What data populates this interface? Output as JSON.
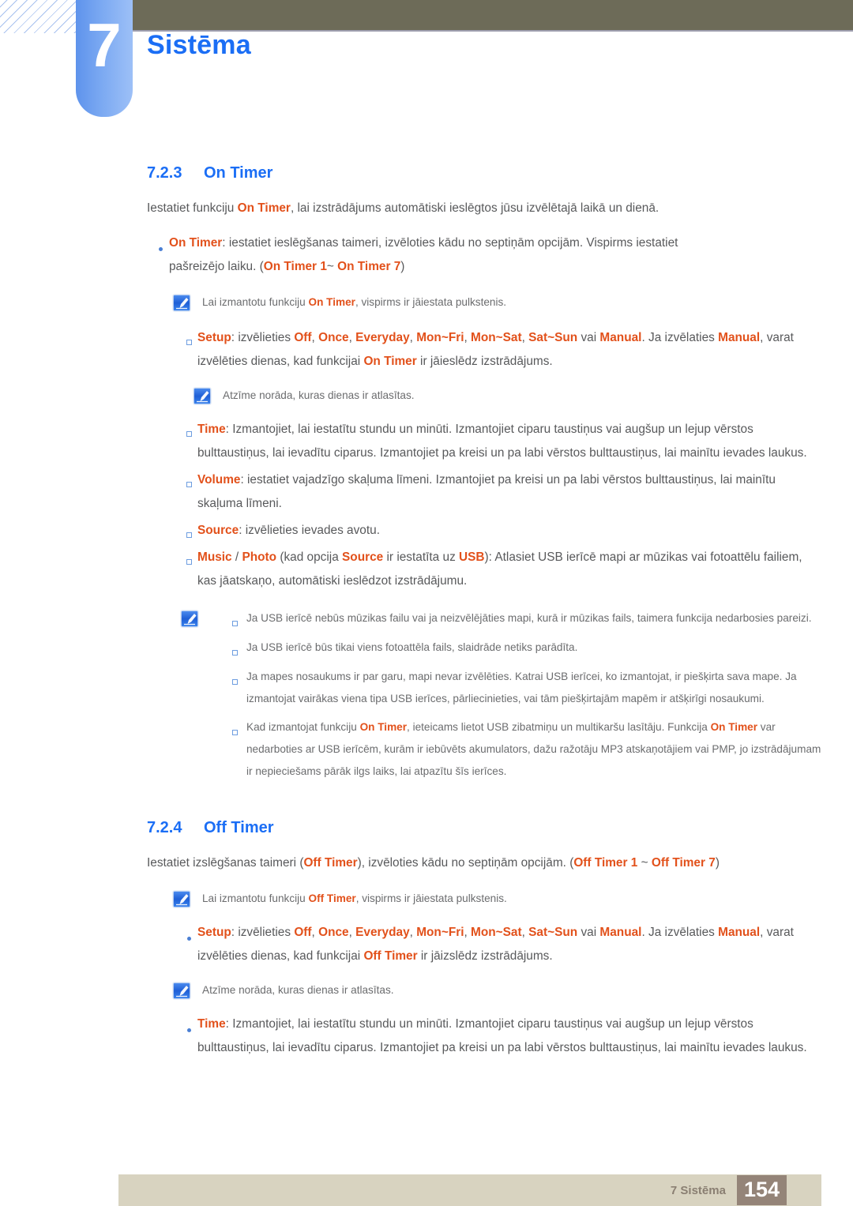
{
  "header": {
    "chapter_number": "7",
    "chapter_title": "Sistēma",
    "bar_color": "#6d6b58",
    "badge_color": "#7ba9f2",
    "title_color": "#1b6ef5"
  },
  "colors": {
    "heading": "#1b6ef5",
    "highlight": "#e2511b",
    "body": "#58595b",
    "footer_bar": "#d8d3c0",
    "footer_page": "#948478"
  },
  "sections": [
    {
      "number": "7.2.3",
      "title": "On Timer",
      "intro": {
        "pre": "Iestatiet funkciju ",
        "term": "On Timer",
        "post": ", lai izstrādājums automātiski ieslēgtos jūsu izvēlētajā laikā un dienā."
      }
    },
    {
      "number": "7.2.4",
      "title": "Off Timer"
    }
  ],
  "on_timer": {
    "bullet_main": {
      "term": "On Timer",
      "line1": ": iestatiet ieslēgšanas taimeri, izvēloties kādu no septiņām opcijām. Vispirms iestatiet",
      "line2_pre": "pašreizējo laiku. (",
      "line2_term1": "On Timer 1",
      "line2_mid": "~ ",
      "line2_term2": "On Timer 7",
      "line2_post": ")"
    },
    "note1": {
      "pre": "Lai izmantotu funkciju ",
      "term": "On Timer",
      "post": ", vispirms ir jāiestata pulkstenis."
    },
    "setup": {
      "term": "Setup",
      "seg1": ": izvēlieties ",
      "options": [
        "Off",
        "Once",
        "Everyday",
        "Mon~Fri",
        "Mon~Sat",
        "Sat~Sun"
      ],
      "seg2": " vai ",
      "manual": "Manual",
      "seg3": ". Ja izvēlaties ",
      "manual2": "Manual",
      "seg4": ", varat izvēlēties dienas, kad funkcijai ",
      "term2": "On Timer",
      "seg5": " ir jāieslēdz izstrādājums."
    },
    "note2": "Atzīme norāda, kuras dienas ir atlasītas.",
    "time": {
      "term": "Time",
      "body": ": Izmantojiet, lai iestatītu stundu un minūti. Izmantojiet ciparu taustiņus vai augšup un lejup vērstos bulttaustiņus, lai ievadītu ciparus. Izmantojiet pa kreisi un pa labi vērstos bulttaustiņus, lai mainītu ievades laukus."
    },
    "volume": {
      "term": "Volume",
      "body": ": iestatiet vajadzīgo skaļuma līmeni. Izmantojiet pa kreisi un pa labi vērstos bulttaustiņus, lai mainītu skaļuma līmeni."
    },
    "source": {
      "term": "Source",
      "body": ": izvēlieties ievades avotu."
    },
    "music_photo": {
      "term1": "Music",
      "sep": " / ",
      "term2": "Photo",
      "seg1": " (kad opcija ",
      "term3": "Source",
      "seg2": " ir iestatīta uz ",
      "term4": "USB",
      "seg3": "): Atlasiet USB ierīcē mapi ar mūzikas vai fotoattēlu failiem, kas jāatskaņo, automātiski ieslēdzot izstrādājumu."
    },
    "note_block": {
      "item1": "Ja USB ierīcē nebūs mūzikas failu vai ja neizvēlējāties mapi, kurā ir mūzikas fails, taimera funkcija nedarbosies pareizi.",
      "item2": "Ja USB ierīcē būs tikai viens fotoattēla fails, slaidrāde netiks parādīta.",
      "item3": "Ja mapes nosaukums ir par garu, mapi nevar izvēlēties. Katrai USB ierīcei, ko izmantojat, ir piešķirta sava mape. Ja izmantojat vairākas viena tipa USB ierīces, pārliecinieties, vai tām piešķirtajām mapēm ir atšķirīgi nosaukumi.",
      "item4_pre": "Kad izmantojat funkciju ",
      "item4_term1": "On Timer",
      "item4_mid": ", ieteicams lietot USB zibatmiņu un multikaršu lasītāju. Funkcija ",
      "item4_term2": "On Timer",
      "item4_post": " var nedarboties ar USB ierīcēm, kurām ir iebūvēts akumulators, dažu ražotāju MP3 atskaņotājiem vai PMP, jo izstrādājumam ir nepieciešams pārāk ilgs laiks, lai atpazītu šīs ierīces."
    }
  },
  "off_timer": {
    "intro_pre": "Iestatiet izslēgšanas taimeri (",
    "intro_term": "Off Timer",
    "intro_mid": "), izvēloties kādu no septiņām opcijām. (",
    "intro_term1": "Off Timer 1",
    "intro_sep": " ~ ",
    "intro_term2": "Off Timer 7",
    "intro_post": ")",
    "note1": {
      "pre": "Lai izmantotu funkciju ",
      "term": "Off Timer",
      "post": ", vispirms ir jāiestata pulkstenis."
    },
    "setup": {
      "term": "Setup",
      "seg1": ": izvēlieties ",
      "options": [
        "Off",
        "Once",
        "Everyday",
        "Mon~Fri",
        "Mon~Sat",
        "Sat~Sun"
      ],
      "seg2": " vai ",
      "manual": "Manual",
      "seg3": ". Ja izvēlaties ",
      "manual2": "Manual",
      "seg4": ", varat izvēlēties dienas, kad funkcijai ",
      "term2": "Off Timer",
      "seg5": " ir jāizslēdz izstrādājums."
    },
    "note2": "Atzīme norāda, kuras dienas ir atlasītas.",
    "time": {
      "term": "Time",
      "body": ": Izmantojiet, lai iestatītu stundu un minūti. Izmantojiet ciparu taustiņus vai augšup un lejup vērstos bulttaustiņus, lai ievadītu ciparus. Izmantojiet pa kreisi un pa labi vērstos bulttaustiņus, lai mainītu ievades laukus."
    }
  },
  "footer": {
    "label": "7 Sistēma",
    "page": "154"
  },
  "icons": {
    "note": "note-pencil-icon"
  }
}
